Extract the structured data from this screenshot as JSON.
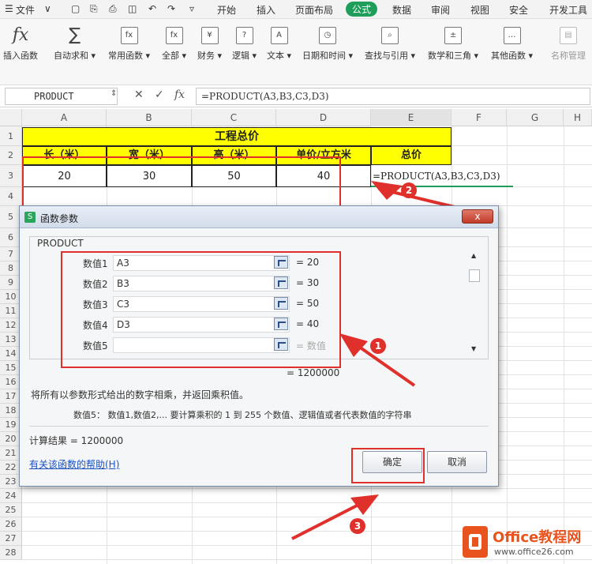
{
  "menubar": {
    "file": "文件",
    "tabs": [
      "开始",
      "插入",
      "页面布局",
      "公式",
      "数据",
      "审阅",
      "视图",
      "安全",
      "开发工具"
    ],
    "active_tab": "公式"
  },
  "ribbon": {
    "items": [
      {
        "label": "插入函数",
        "icon": "fx-icon"
      },
      {
        "label": "自动求和",
        "icon": "sigma-icon"
      },
      {
        "label": "常用函数",
        "icon": "star-function-icon"
      },
      {
        "label": "全部",
        "icon": "function-icon"
      },
      {
        "label": "财务",
        "icon": "yen-icon"
      },
      {
        "label": "逻辑",
        "icon": "question-icon"
      },
      {
        "label": "文本",
        "icon": "text-a-icon"
      },
      {
        "label": "日期和时间",
        "icon": "clock-icon"
      },
      {
        "label": "查找与引用",
        "icon": "lookup-icon"
      },
      {
        "label": "数学和三角",
        "icon": "math-icon"
      },
      {
        "label": "其他函数",
        "icon": "more-icon"
      },
      {
        "label": "名称管理",
        "icon": "name-manager-icon"
      }
    ]
  },
  "formula_bar": {
    "name_box": "PRODUCT",
    "formula": "=PRODUCT(A3,B3,C3,D3)"
  },
  "sheet": {
    "columns": [
      "A",
      "B",
      "C",
      "D",
      "E",
      "F",
      "G",
      "H"
    ],
    "rows": [
      "1",
      "2",
      "3",
      "4",
      "5",
      "6",
      "7",
      "8",
      "9",
      "10",
      "11",
      "12",
      "13",
      "14",
      "15",
      "16",
      "17",
      "18",
      "19",
      "20",
      "21",
      "22",
      "23",
      "24",
      "25",
      "26",
      "27",
      "28"
    ],
    "title": "工程总价",
    "headers": [
      "长（米）",
      "宽（米）",
      "高（米）",
      "单价/立方米",
      "总价"
    ],
    "row3": [
      "20",
      "30",
      "50",
      "40"
    ],
    "e3_formula": "=PRODUCT(A3,B3,C3,D3)"
  },
  "dialog": {
    "title": "函数参数",
    "close": "x",
    "function_name": "PRODUCT",
    "args": [
      {
        "label": "数值1",
        "value": "A3",
        "result": "20"
      },
      {
        "label": "数值2",
        "value": "B3",
        "result": "30"
      },
      {
        "label": "数值3",
        "value": "C3",
        "result": "50"
      },
      {
        "label": "数值4",
        "value": "D3",
        "result": "40"
      },
      {
        "label": "数值5",
        "value": "",
        "result": "数值"
      }
    ],
    "result_line": "= 1200000",
    "description": "将所有以参数形式给出的数字相乘，并返回乘积值。",
    "arg_description": "数值5：  数值1,数值2,... 要计算乘积的 1 到 255 个数值、逻辑值或者代表数值的字符串",
    "calc_result": "计算结果 =  1200000",
    "help_link": "有关该函数的帮助(H)",
    "ok": "确定",
    "cancel": "取消"
  },
  "annotations": {
    "badges": [
      "1",
      "2",
      "3"
    ],
    "color": "#e0302b"
  },
  "watermark": {
    "brand": "Office教程网",
    "url": "www.office26.com"
  }
}
